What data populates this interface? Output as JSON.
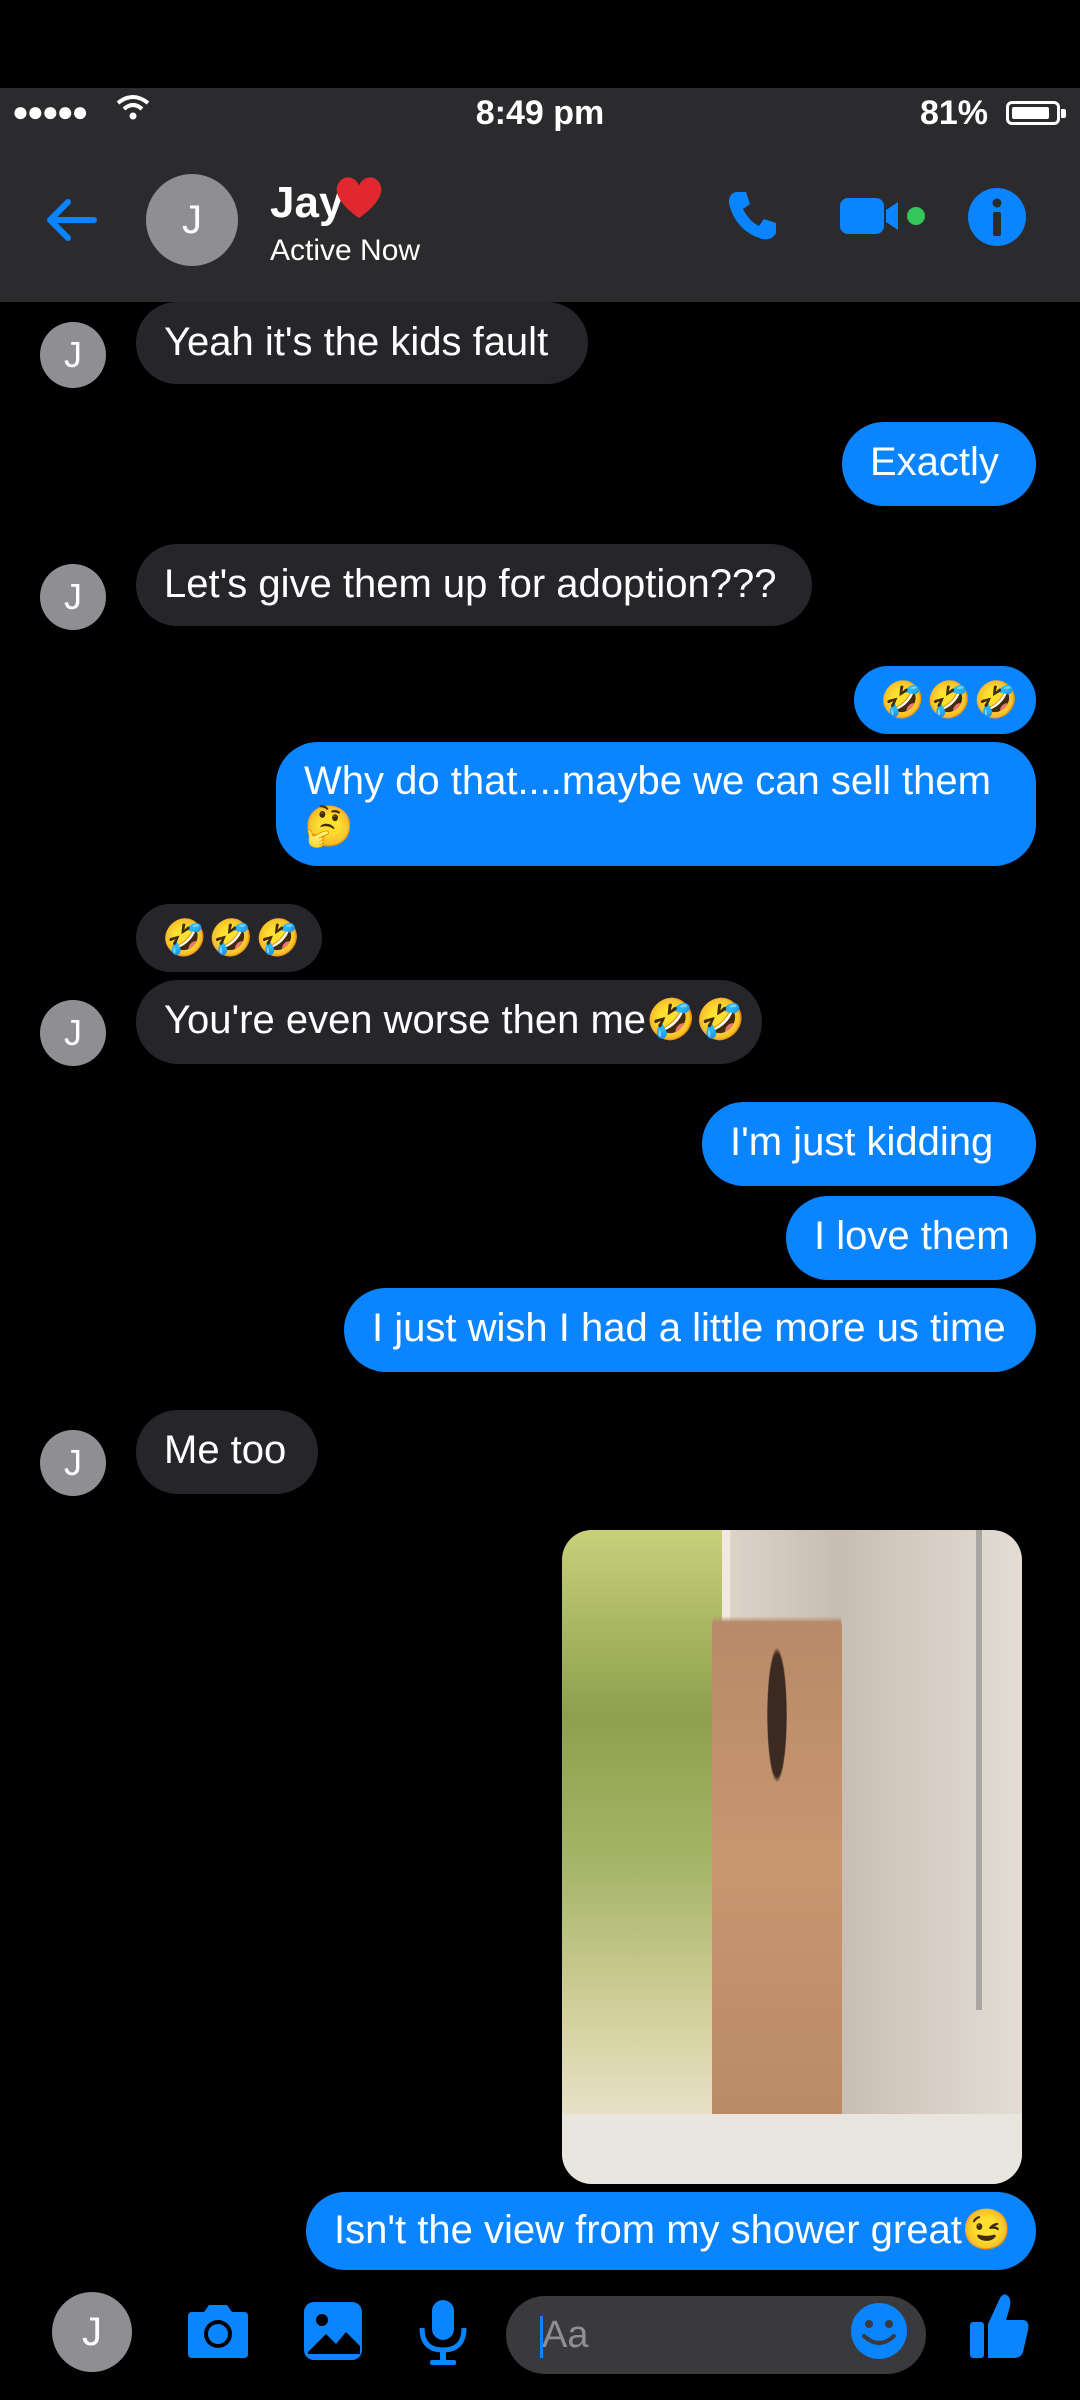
{
  "status_bar": {
    "signal": "●●●●●",
    "time": "8:49 pm",
    "battery_pct": "81%"
  },
  "header": {
    "avatar_letter": "J",
    "name": "Jay",
    "name_emoji": "❤️",
    "status": "Active Now",
    "icons": [
      "back-arrow-icon",
      "phone-icon",
      "video-camera-icon",
      "info-icon"
    ]
  },
  "messages": {
    "m1": "Yeah it's the kids fault",
    "m2": "Exactly",
    "m3": "Let's give them up for adoption???",
    "m4": "🤣🤣🤣",
    "m5_line1": "Why do that....maybe we can sell them",
    "m5_line2": "🤔",
    "m6": "🤣🤣🤣",
    "m7": "You're even worse then me🤣🤣",
    "m8": "I'm just kidding",
    "m9": "I love them",
    "m10": "I just wish I had a little more us time",
    "m11": "Me too",
    "m12": "Isn't the view from my shower great😉"
  },
  "avatars": {
    "letter": "J"
  },
  "composer": {
    "placeholder": "Aa",
    "avatar_letter": "J",
    "icons": [
      "camera-icon",
      "image-icon",
      "microphone-icon",
      "emoji-icon",
      "thumbs-up-icon"
    ]
  },
  "colors": {
    "accent": "#0a84ff",
    "incoming": "#26252a",
    "bar": "#2b2b2e"
  }
}
